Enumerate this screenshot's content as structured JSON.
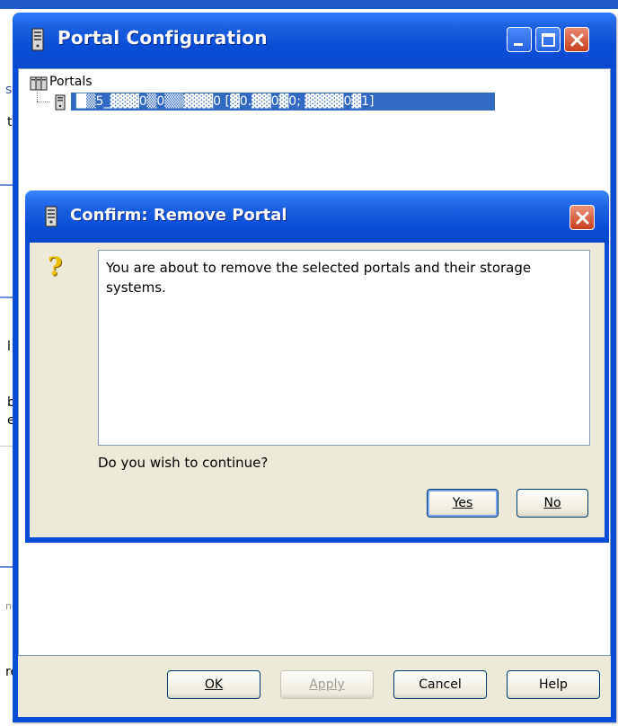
{
  "background_fragments": [
    "s",
    "t",
    "l",
    "b",
    "e",
    "ne",
    "re"
  ],
  "window": {
    "title": "Portal Configuration",
    "tree": {
      "root_label": "Portals",
      "child_label": "█▒5_▓▓▓0▒0▒▒▓▓▓0 [▓0.▓▓0▓0; ▓▓▓▓0▓1]"
    },
    "buttons": {
      "ok": "OK",
      "apply": "Apply",
      "cancel": "Cancel",
      "help": "Help"
    }
  },
  "dialog": {
    "title": "Confirm: Remove Portal",
    "message": "You are about to remove the selected portals and their storage systems.",
    "prompt": "Do you wish to continue?",
    "yes": "Yes",
    "no": "No"
  },
  "colors": {
    "titlebar": "#0a4ed8",
    "selection": "#316ac5",
    "close_button": "#c63e1c",
    "dialog_face": "#ece9d8"
  }
}
